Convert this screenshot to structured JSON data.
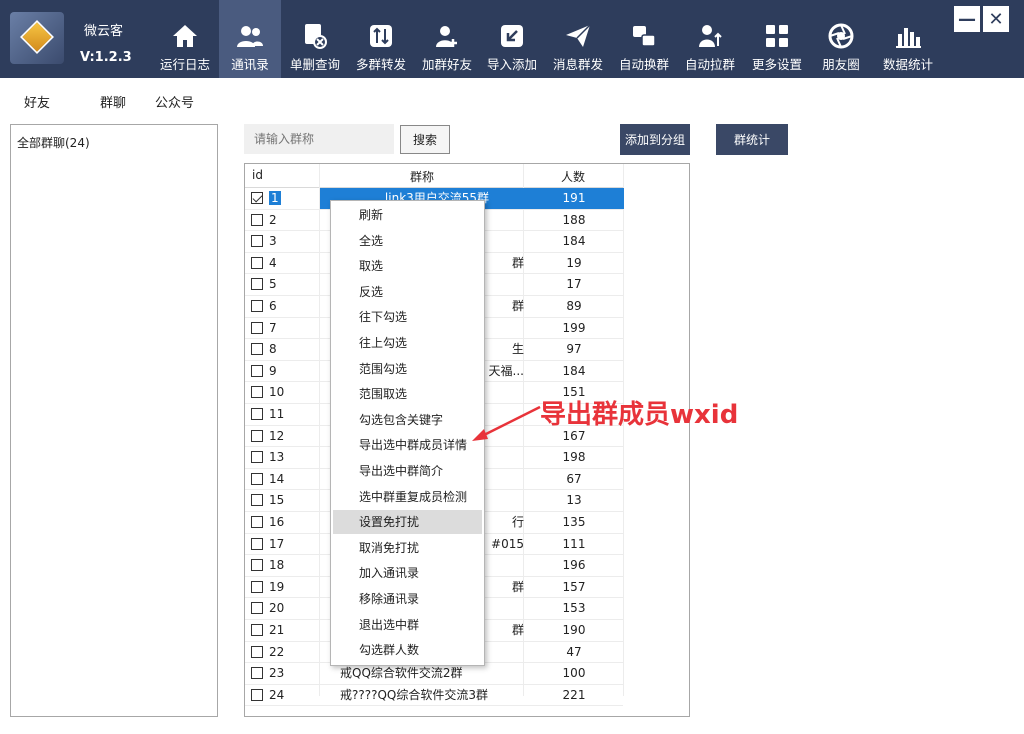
{
  "app": {
    "name": "微云客",
    "version": "V:1.2.3"
  },
  "toolbar": {
    "items": [
      {
        "label": "运行日志",
        "icon": "home-icon"
      },
      {
        "label": "通讯录",
        "icon": "contacts-icon",
        "active": true
      },
      {
        "label": "单删查询",
        "icon": "delete-check-icon"
      },
      {
        "label": "多群转发",
        "icon": "forward-icon"
      },
      {
        "label": "加群好友",
        "icon": "add-friend-icon"
      },
      {
        "label": "导入添加",
        "icon": "import-icon"
      },
      {
        "label": "消息群发",
        "icon": "send-icon"
      },
      {
        "label": "自动换群",
        "icon": "switch-group-icon"
      },
      {
        "label": "自动拉群",
        "icon": "pull-group-icon"
      },
      {
        "label": "更多设置",
        "icon": "grid-icon"
      },
      {
        "label": "朋友圈",
        "icon": "aperture-icon"
      },
      {
        "label": "数据统计",
        "icon": "bar-chart-icon"
      }
    ],
    "minimize": "—",
    "close": "✕"
  },
  "subtabs": [
    "好友",
    "群聊",
    "公众号"
  ],
  "left_panel": {
    "item": "全部群聊(24)"
  },
  "search": {
    "placeholder": "请输入群称",
    "button": "搜索"
  },
  "actions": {
    "add_to_group": "添加到分组",
    "group_stats": "群统计"
  },
  "table": {
    "headers": {
      "id": "id",
      "name": "群称",
      "count": "人数"
    },
    "rows": [
      {
        "id": "1",
        "name": "link3用户交流55群",
        "count": "191",
        "checked": true,
        "selected": true
      },
      {
        "id": "2",
        "name": "",
        "count": "188"
      },
      {
        "id": "3",
        "name": "",
        "count": "184"
      },
      {
        "id": "4",
        "name": "群",
        "count": "19"
      },
      {
        "id": "5",
        "name": "",
        "count": "17"
      },
      {
        "id": "6",
        "name": "群",
        "count": "89"
      },
      {
        "id": "7",
        "name": "",
        "count": "199"
      },
      {
        "id": "8",
        "name": "生",
        "count": "97"
      },
      {
        "id": "9",
        "name": "天福...",
        "count": "184"
      },
      {
        "id": "10",
        "name": "",
        "count": "151"
      },
      {
        "id": "11",
        "name": "",
        "count": ""
      },
      {
        "id": "12",
        "name": "",
        "count": "167"
      },
      {
        "id": "13",
        "name": "",
        "count": "198"
      },
      {
        "id": "14",
        "name": "",
        "count": "67"
      },
      {
        "id": "15",
        "name": "",
        "count": "13"
      },
      {
        "id": "16",
        "name": "行",
        "count": "135"
      },
      {
        "id": "17",
        "name": "#015",
        "count": "111"
      },
      {
        "id": "18",
        "name": "",
        "count": "196"
      },
      {
        "id": "19",
        "name": "群",
        "count": "157"
      },
      {
        "id": "20",
        "name": "",
        "count": "153"
      },
      {
        "id": "21",
        "name": "群",
        "count": "190"
      },
      {
        "id": "22",
        "name": "",
        "count": "47"
      },
      {
        "id": "23",
        "name": "戒QQ综合软件交流2群",
        "count": "100"
      },
      {
        "id": "24",
        "name": "戒????QQ综合软件交流3群",
        "count": "221"
      }
    ]
  },
  "context_menu": {
    "items": [
      "刷新",
      "全选",
      "取选",
      "反选",
      "往下勾选",
      "往上勾选",
      "范围勾选",
      "范围取选",
      "勾选包含关键字",
      "导出选中群成员详情",
      "导出选中群简介",
      "选中群重复成员检测",
      "设置免打扰",
      "取消免打扰",
      "加入通讯录",
      "移除通讯录",
      "退出选中群",
      "勾选群人数"
    ],
    "hover_index": 12
  },
  "annotation": {
    "text": "导出群成员wxid",
    "color": "#e8333a"
  },
  "colors": {
    "toolbar_bg": "#2e3d5c",
    "selection": "#1e7fd6",
    "button_dark": "#3a4866"
  }
}
